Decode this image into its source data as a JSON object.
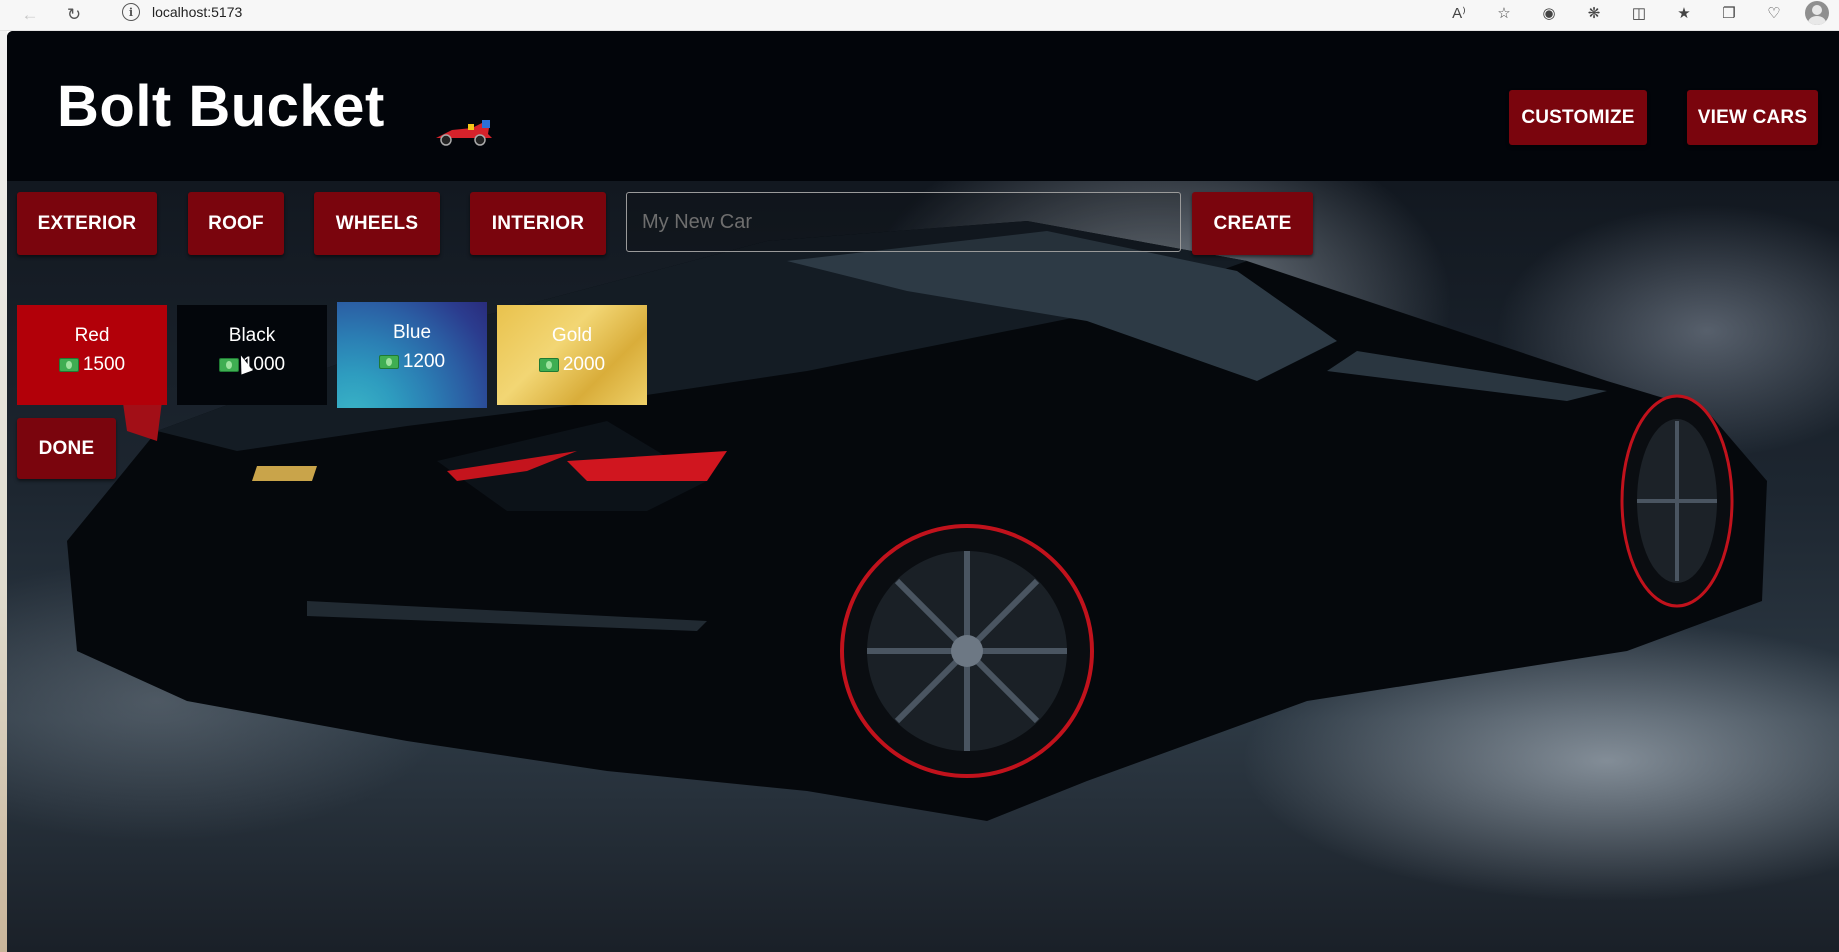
{
  "browser": {
    "url": "localhost:5173",
    "back_icon": "back-arrow-icon",
    "reload_icon": "reload-icon",
    "info_icon": "info-icon",
    "info_glyph": "i",
    "toolbar_icons": [
      "read-aloud-icon",
      "favorite-star-icon",
      "copilot-icon",
      "extensions-icon",
      "split-screen-icon",
      "favorites-icon",
      "collections-icon",
      "browser-essentials-icon",
      "profile-avatar-icon"
    ]
  },
  "app": {
    "brand": "Bolt Bucket",
    "header_buttons": {
      "customize": "CUSTOMIZE",
      "view_cars": "VIEW CARS"
    },
    "toolbar": {
      "exterior": "EXTERIOR",
      "roof": "ROOF",
      "wheels": "WHEELS",
      "interior": "INTERIOR",
      "name_placeholder": "My New Car",
      "name_value": "",
      "create": "CREATE"
    },
    "colors": [
      {
        "name": "Red",
        "price": "1500",
        "color": "#b20009"
      },
      {
        "name": "Black",
        "price": "1000",
        "color": "#03060b"
      },
      {
        "name": "Blue",
        "price": "1200",
        "color": "#2b5fa4"
      },
      {
        "name": "Gold",
        "price": "2000",
        "color": "#e9c24d"
      }
    ],
    "done": "DONE",
    "accent_color": "#7a050d"
  }
}
